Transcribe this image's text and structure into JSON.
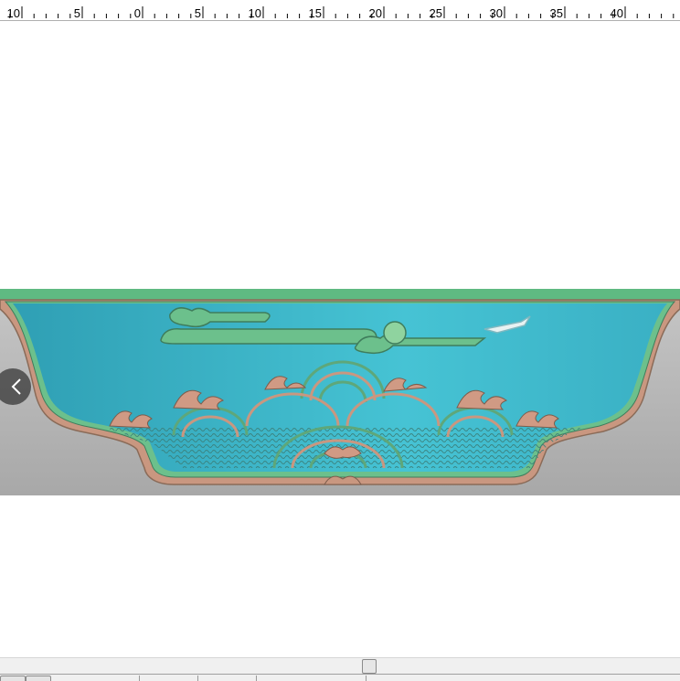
{
  "ruler": {
    "labels": [
      "10",
      "5",
      "0",
      "5",
      "10",
      "15",
      "20",
      "25",
      "30",
      "35",
      "40"
    ]
  },
  "canvas": {
    "image_description_icon": "carved-relief-image",
    "colors": {
      "sky": "#3fb8c8",
      "frame_green": "#5fba82",
      "frame_pink": "#c99780",
      "background_gray": "#b8b8b8"
    }
  },
  "nav": {
    "prev_icon": "chevron-left-icon"
  }
}
